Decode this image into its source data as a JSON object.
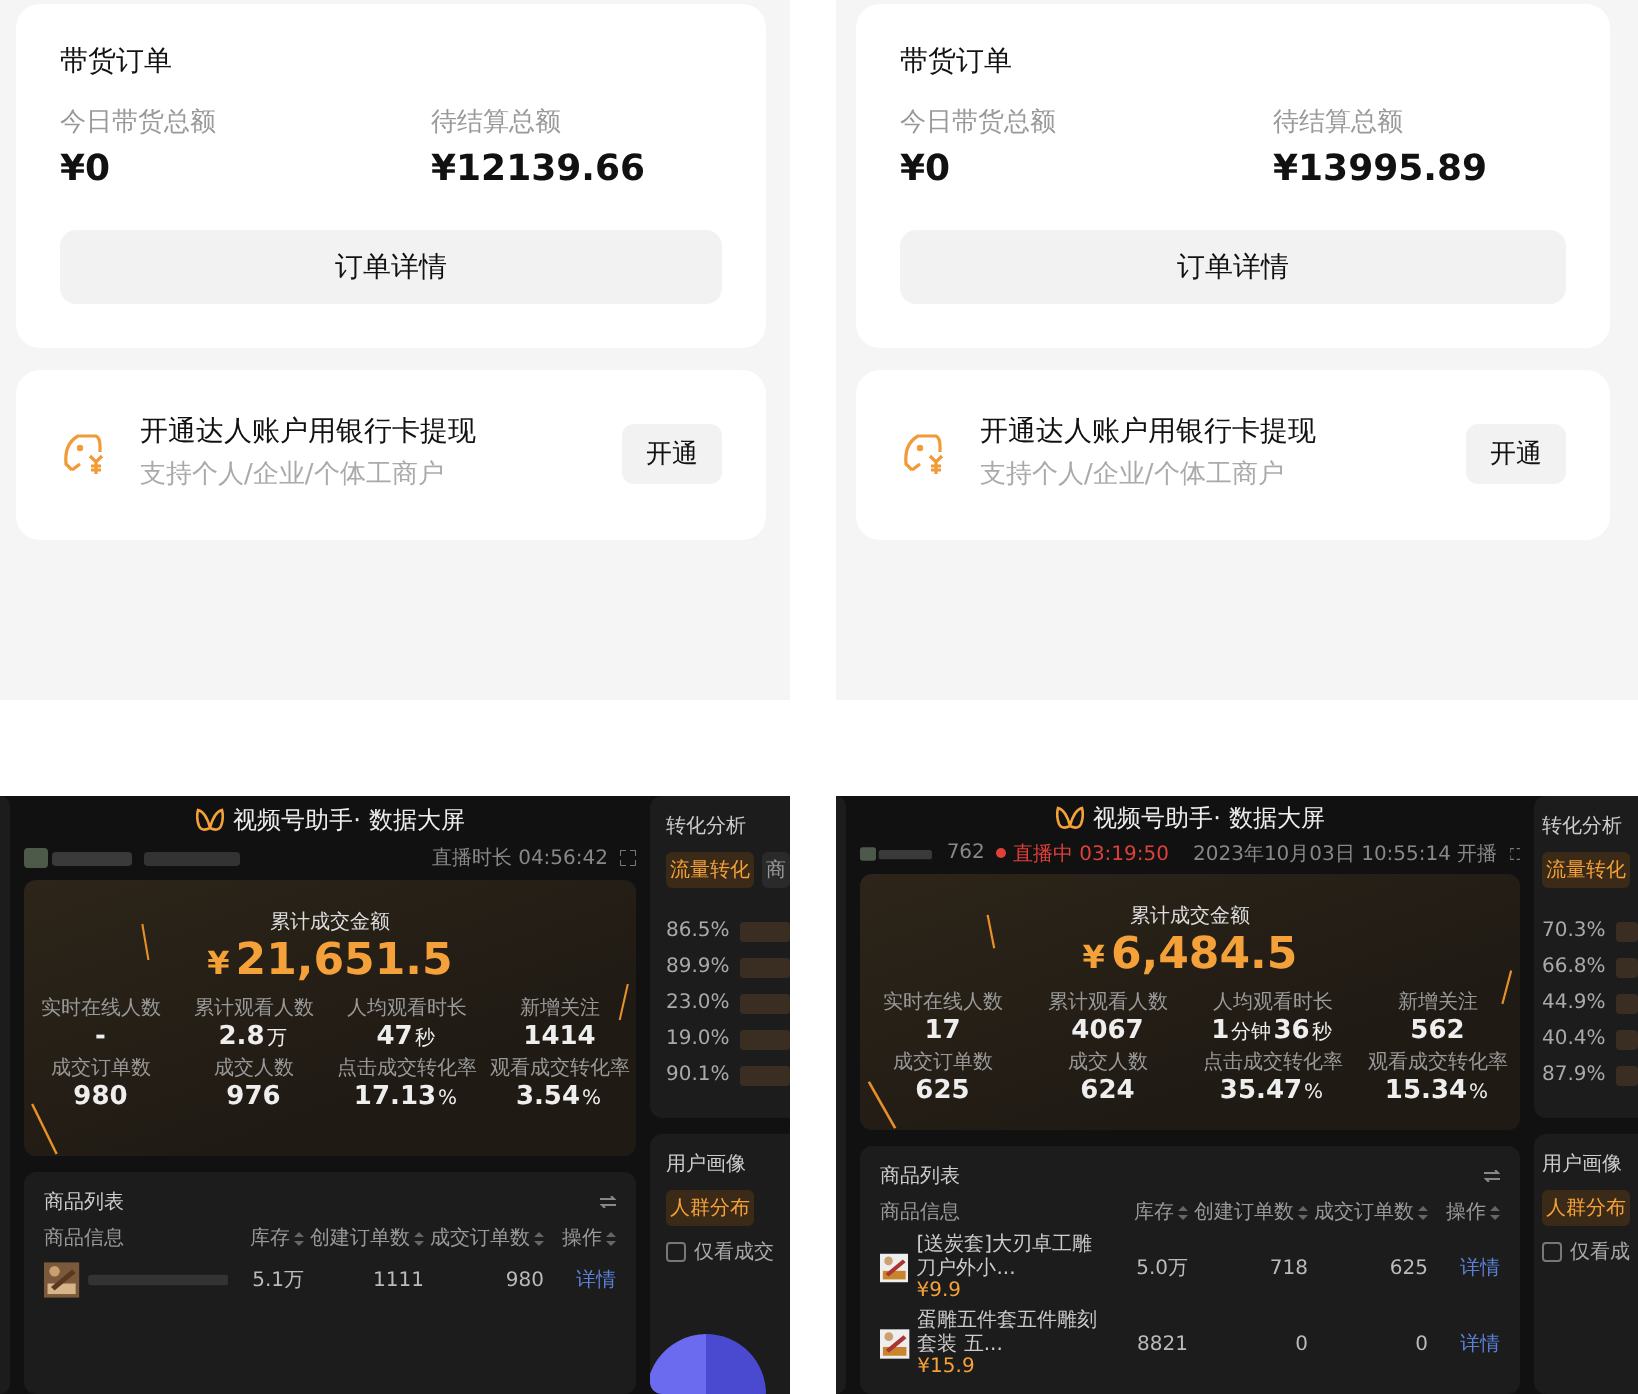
{
  "phone_screens": [
    {
      "order_card": {
        "title": "带货订单",
        "stats": [
          {
            "label": "今日带货总额",
            "value": "¥0"
          },
          {
            "label": "待结算总额",
            "value": "¥12139.66"
          }
        ],
        "button": "订单详情"
      },
      "bank_card": {
        "title": "开通达人账户用银行卡提现",
        "subtitle": "支持个人/企业/个体工商户",
        "button": "开通"
      }
    },
    {
      "order_card": {
        "title": "带货订单",
        "stats": [
          {
            "label": "今日带货总额",
            "value": "¥0"
          },
          {
            "label": "待结算总额",
            "value": "¥13995.89"
          }
        ],
        "button": "订单详情"
      },
      "bank_card": {
        "title": "开通达人账户用银行卡提现",
        "subtitle": "支持个人/企业/个体工商户",
        "button": "开通"
      }
    }
  ],
  "dashboards": [
    {
      "title": "视频号助手· 数据大屏",
      "header": {
        "time_text": "直播时长 04:56:42"
      },
      "total": {
        "label": "累计成交金额",
        "currency": "¥",
        "value": "21,651.5"
      },
      "stats": [
        {
          "label": "实时在线人数",
          "parts": [
            {
              "text": "-",
              "kind": "num"
            }
          ]
        },
        {
          "label": "累计观看人数",
          "parts": [
            {
              "text": "2.8",
              "kind": "num"
            },
            {
              "text": "万",
              "kind": "unit"
            }
          ]
        },
        {
          "label": "人均观看时长",
          "parts": [
            {
              "text": "47",
              "kind": "num"
            },
            {
              "text": "秒",
              "kind": "unit"
            }
          ]
        },
        {
          "label": "新增关注",
          "parts": [
            {
              "text": "1414",
              "kind": "num"
            }
          ]
        },
        {
          "label": "成交订单数",
          "parts": [
            {
              "text": "980",
              "kind": "num"
            }
          ]
        },
        {
          "label": "成交人数",
          "parts": [
            {
              "text": "976",
              "kind": "num"
            }
          ]
        },
        {
          "label": "点击成交转化率",
          "parts": [
            {
              "text": "17.13",
              "kind": "num"
            },
            {
              "text": "%",
              "kind": "unit"
            }
          ]
        },
        {
          "label": "观看成交转化率",
          "parts": [
            {
              "text": "3.54",
              "kind": "num"
            },
            {
              "text": "%",
              "kind": "unit"
            }
          ]
        }
      ],
      "conversion": {
        "title": "转化分析",
        "tabs": [
          {
            "label": "流量转化",
            "selected": true
          },
          {
            "label": "商",
            "selected": false
          }
        ],
        "rates": [
          "86.5%",
          "89.9%",
          "23.0%",
          "19.0%",
          "90.1%"
        ]
      },
      "products": {
        "title": "商品列表",
        "columns": [
          "商品信息",
          "库存",
          "创建订单数",
          "成交订单数",
          "操作"
        ],
        "rows": [
          {
            "cells": [
              "",
              "5.1万",
              "1111",
              "980",
              "详情"
            ]
          }
        ]
      },
      "profile": {
        "title": "用户画像",
        "tabs": [
          {
            "label": "人群分布",
            "selected": true
          }
        ],
        "checkbox": {
          "label": "仅看成交",
          "checked": false
        },
        "pie_visible": true
      }
    },
    {
      "title": "视频号助手· 数据大屏",
      "header": {
        "account_suffix": "762",
        "live_status": "直播中 03:19:50",
        "time_text": "2023年10月03日 10:55:14 开播"
      },
      "total": {
        "label": "累计成交金额",
        "currency": "¥",
        "value": "6,484.5"
      },
      "stats": [
        {
          "label": "实时在线人数",
          "parts": [
            {
              "text": "17",
              "kind": "num"
            }
          ]
        },
        {
          "label": "累计观看人数",
          "parts": [
            {
              "text": "4067",
              "kind": "num"
            }
          ]
        },
        {
          "label": "人均观看时长",
          "parts": [
            {
              "text": "1",
              "kind": "num"
            },
            {
              "text": "分钟",
              "kind": "unit"
            },
            {
              "text": "36",
              "kind": "num"
            },
            {
              "text": "秒",
              "kind": "unit"
            }
          ]
        },
        {
          "label": "新增关注",
          "parts": [
            {
              "text": "562",
              "kind": "num"
            }
          ]
        },
        {
          "label": "成交订单数",
          "parts": [
            {
              "text": "625",
              "kind": "num"
            }
          ]
        },
        {
          "label": "成交人数",
          "parts": [
            {
              "text": "624",
              "kind": "num"
            }
          ]
        },
        {
          "label": "点击成交转化率",
          "parts": [
            {
              "text": "35.47",
              "kind": "num"
            },
            {
              "text": "%",
              "kind": "unit"
            }
          ]
        },
        {
          "label": "观看成交转化率",
          "parts": [
            {
              "text": "15.34",
              "kind": "num"
            },
            {
              "text": "%",
              "kind": "unit"
            }
          ]
        }
      ],
      "conversion": {
        "title": "转化分析",
        "tabs": [
          {
            "label": "流量转化",
            "selected": true
          }
        ],
        "rates": [
          "70.3%",
          "66.8%",
          "44.9%",
          "40.4%",
          "87.9%"
        ]
      },
      "products": {
        "title": "商品列表",
        "columns": [
          "商品信息",
          "库存",
          "创建订单数",
          "成交订单数",
          "操作"
        ],
        "rows": [
          {
            "cells": [
              "[送炭套]大刃卓工雕刀户外小...",
              "5.0万",
              "718",
              "625",
              "详情"
            ],
            "price": "¥9.9"
          },
          {
            "cells": [
              "蛋雕五件套五件雕刻套装 五...",
              "8821",
              "0",
              "0",
              "详情"
            ],
            "price": "¥15.9"
          }
        ]
      },
      "profile": {
        "title": "用户画像",
        "tabs": [
          {
            "label": "人群分布",
            "selected": true
          }
        ],
        "checkbox": {
          "label": "仅看成",
          "checked": false
        }
      }
    }
  ]
}
